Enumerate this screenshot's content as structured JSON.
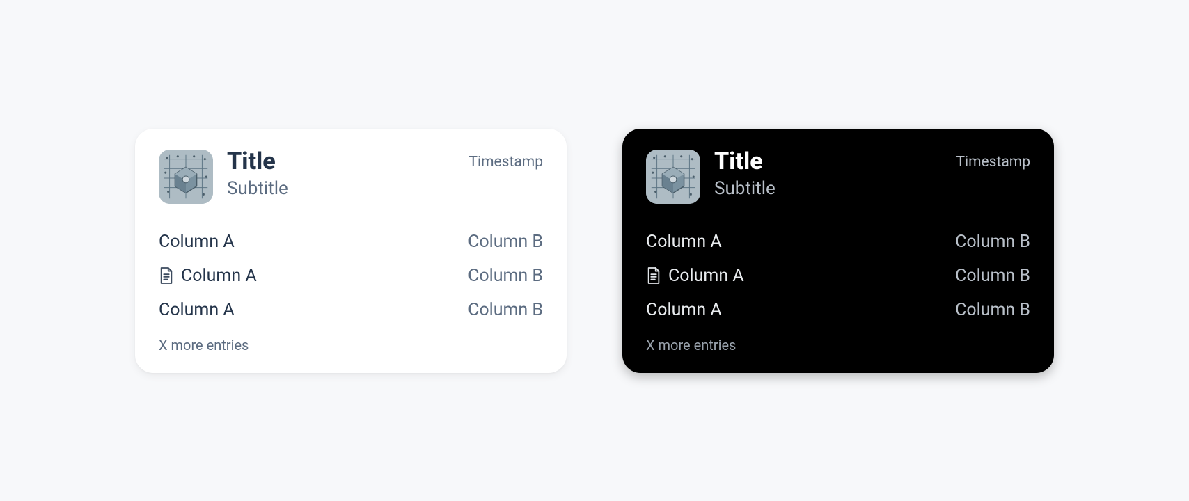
{
  "cards": {
    "light": {
      "title": "Title",
      "subtitle": "Subtitle",
      "timestamp": "Timestamp",
      "rows": [
        {
          "a": "Column A",
          "b": "Column B",
          "has_icon": false
        },
        {
          "a": "Column A",
          "b": "Column B",
          "has_icon": true
        },
        {
          "a": "Column A",
          "b": "Column B",
          "has_icon": false
        }
      ],
      "more": "X more entries"
    },
    "dark": {
      "title": "Title",
      "subtitle": "Subtitle",
      "timestamp": "Timestamp",
      "rows": [
        {
          "a": "Column A",
          "b": "Column B",
          "has_icon": false
        },
        {
          "a": "Column A",
          "b": "Column B",
          "has_icon": true
        },
        {
          "a": "Column A",
          "b": "Column B",
          "has_icon": false
        }
      ],
      "more": "X more entries"
    }
  },
  "icons": {
    "avatar": "abstract-blueprint-icon",
    "row": "document-icon"
  }
}
